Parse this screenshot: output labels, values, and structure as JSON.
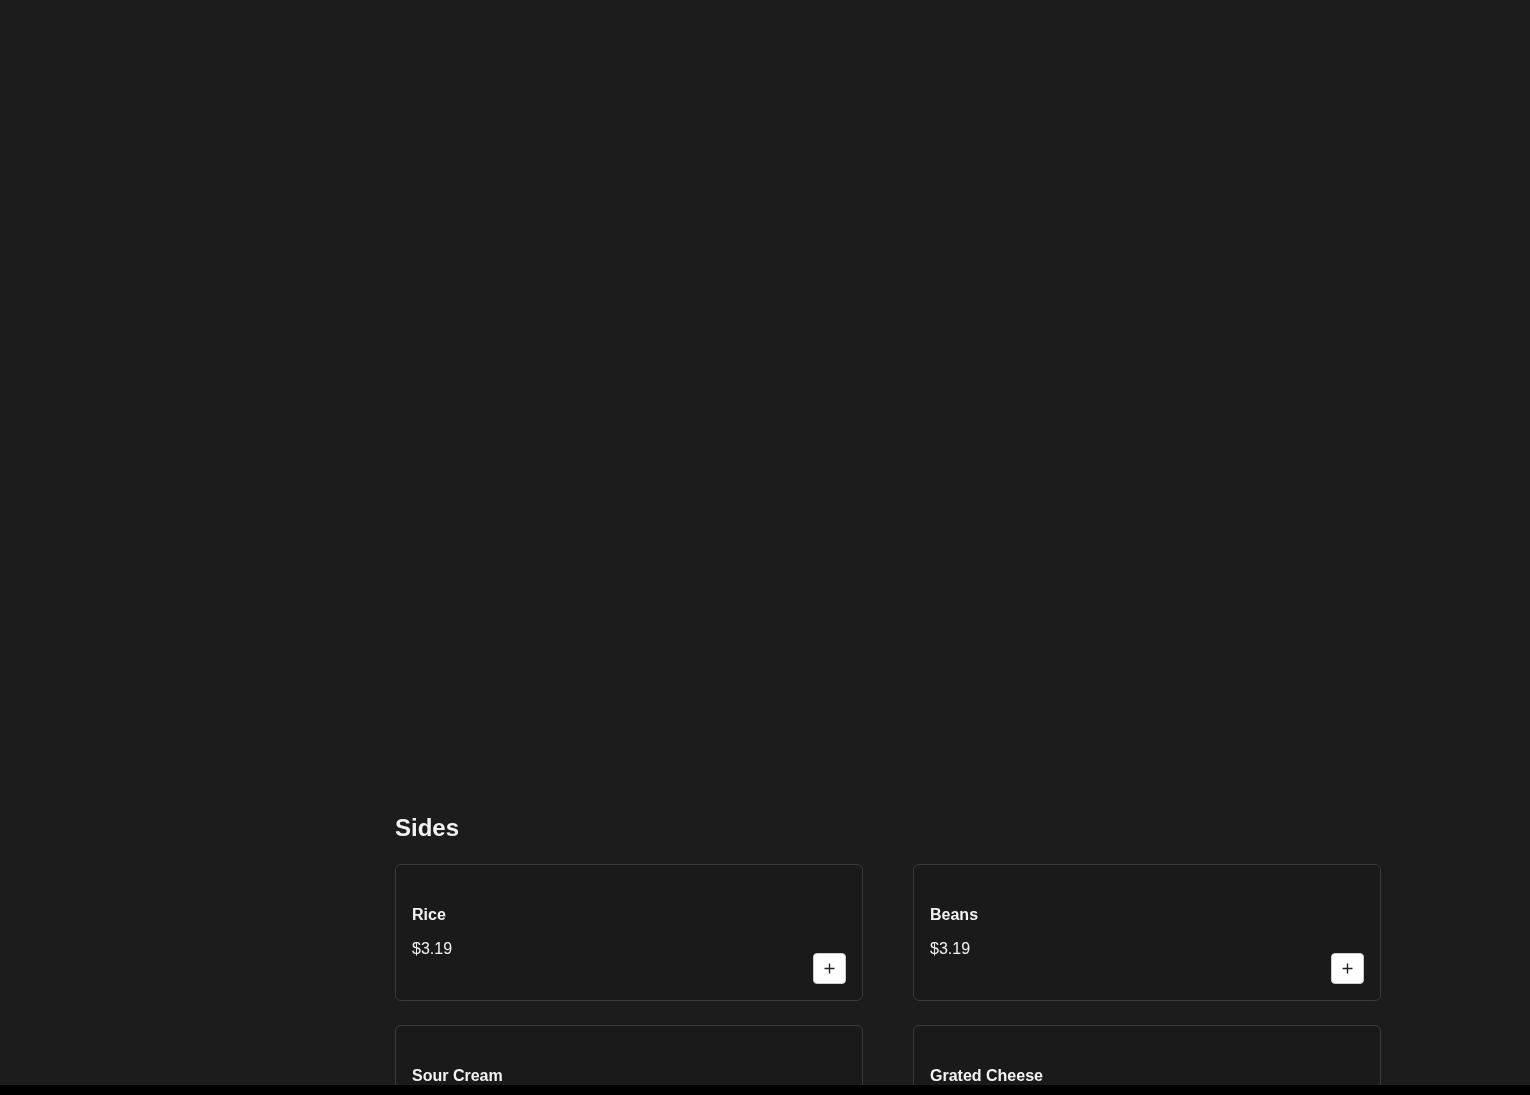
{
  "section": {
    "title": "Sides",
    "items": [
      {
        "name": "Rice",
        "price": "$3.19",
        "add_button": true
      },
      {
        "name": "Beans",
        "price": "$3.19",
        "add_button": true
      },
      {
        "name": "Sour Cream"
      },
      {
        "name": "Grated Cheese"
      }
    ]
  }
}
